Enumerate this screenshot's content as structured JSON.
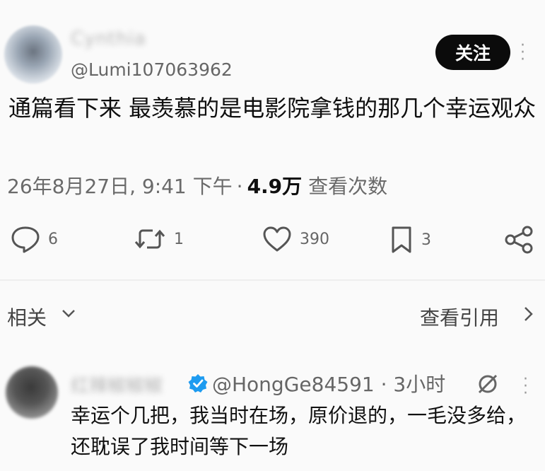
{
  "tweet": {
    "display_name": "Cynthia",
    "handle": "@Lumi107063962",
    "follow_label": "关注",
    "text": "通篇看下来 最羡慕的是电影院拿钱的那几个幸运观众",
    "timestamp": "26年8月27日, 9:41 下午",
    "views_count": "4.9万",
    "views_label": "查看次数"
  },
  "actions": {
    "replies": "6",
    "retweets": "1",
    "likes": "390",
    "bookmarks": "3"
  },
  "related": {
    "label": "相关",
    "view_quotes": "查看引用"
  },
  "reply": {
    "display_name": "红辣椒椒椒",
    "meta": "@HongGe84591 · 3小时",
    "text": "幸运个几把，我当时在场，原价退的，一毛没多给，还耽误了我时间等下一场"
  },
  "colors": {
    "verified": "#1d9bf0",
    "follow_bg": "#0b0b0b"
  }
}
